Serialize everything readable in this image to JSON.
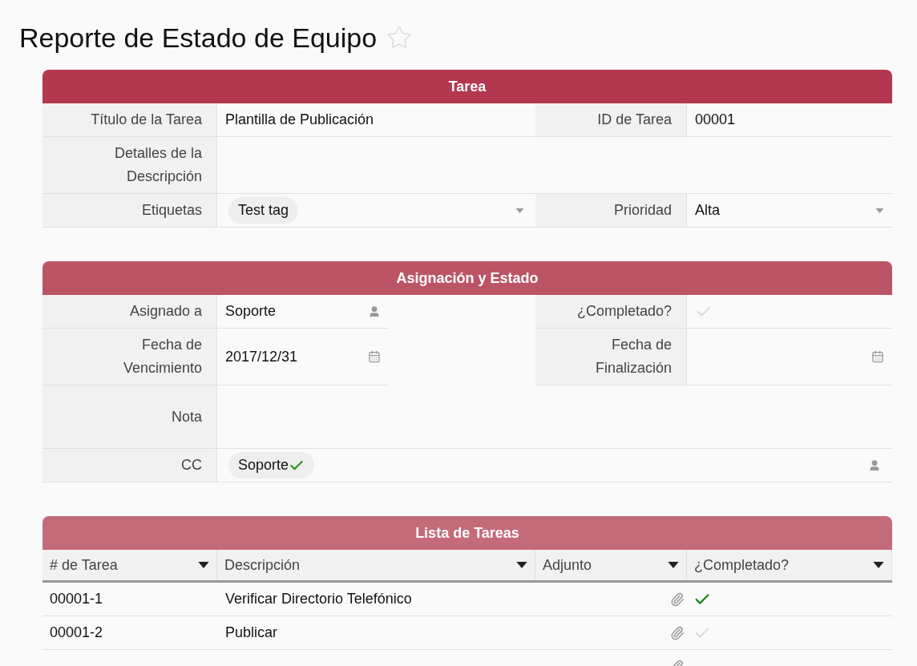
{
  "title": "Reporte de Estado de Equipo",
  "favorite": false,
  "sections": [
    {
      "title": "Tarea",
      "kind": "form",
      "color": "#b3374e",
      "rows": [
        [
          {
            "label": "Título de la Tarea",
            "kind": "text",
            "value": "Plantilla de Publicación"
          },
          {
            "label": "ID de Tarea",
            "kind": "text",
            "value": "00001"
          }
        ],
        [
          {
            "label": "Detalles de la Descripción",
            "kind": "text"
          }
        ],
        [
          {
            "label": "Etiquetas",
            "kind": "tags",
            "tags": [
              {
                "label": "Test tag",
                "verified": false
              }
            ]
          },
          {
            "label": "Prioridad",
            "kind": "select",
            "value": "Alta"
          }
        ]
      ]
    },
    {
      "title": "Asignación y Estado",
      "kind": "form",
      "color": "#bb5566",
      "rows": [
        [
          {
            "label": "Asignado a",
            "kind": "user",
            "value": "Soporte"
          },
          {
            "label": "¿Completado?",
            "kind": "check",
            "checked": false
          }
        ],
        [
          {
            "label": "Fecha de Vencimiento",
            "kind": "date",
            "value": "2017/12/31"
          },
          {
            "label": "Fecha de Finalización",
            "kind": "date"
          }
        ],
        [
          {
            "label": "Nota",
            "kind": "note"
          }
        ],
        [
          {
            "label": "CC",
            "kind": "users",
            "tags": [
              {
                "label": "Soporte",
                "verified": true
              }
            ]
          }
        ]
      ]
    },
    {
      "title": "Lista de Tareas",
      "kind": "table",
      "color": "#c46b7a",
      "columns": [
        "# de Tarea",
        "Descripción",
        "Adjunto",
        "¿Completado?"
      ],
      "rows": [
        {
          "task": "00001-1",
          "description": "Verificar Directorio Telefónico",
          "completed": true
        },
        {
          "task": "00001-2",
          "description": "Publicar",
          "completed": false
        },
        {}
      ]
    }
  ]
}
